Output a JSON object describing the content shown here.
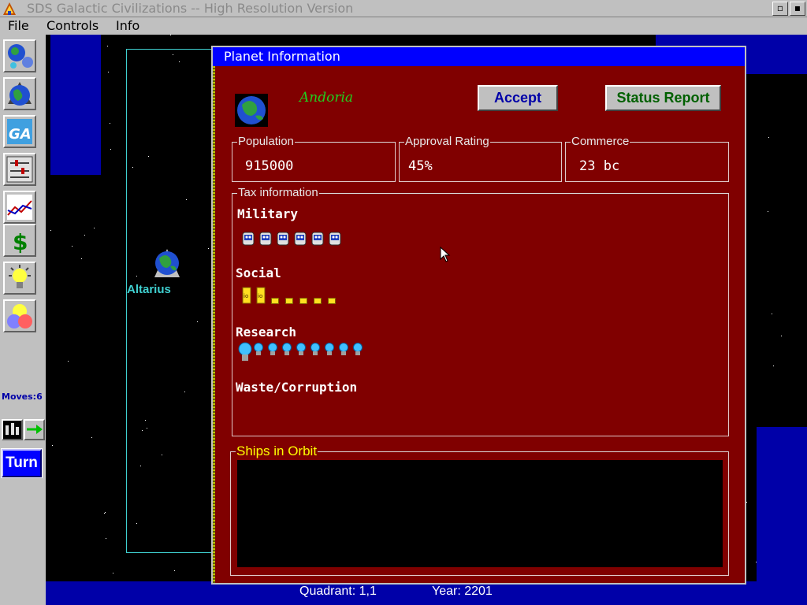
{
  "window": {
    "title": "SDS Galactic Civilizations -- High Resolution Version",
    "restore_label": "▫",
    "close_label": "▪"
  },
  "menu": [
    {
      "label": "File"
    },
    {
      "label": "Controls"
    },
    {
      "label": "Info"
    }
  ],
  "sidebar": {
    "moves_label": "Moves:6",
    "turn_label": "Turn"
  },
  "map": {
    "planet_label": "Altarius"
  },
  "status": {
    "quadrant": "Quadrant: 1,1",
    "year": "Year: 2201"
  },
  "dialog": {
    "title": "Planet Information",
    "planet_name": "Andoria",
    "accept_label": "Accept",
    "status_report_label": "Status Report",
    "population": {
      "legend": "Population",
      "value": "915000"
    },
    "approval": {
      "legend": "Approval Rating",
      "value": "45%"
    },
    "commerce": {
      "legend": "Commerce",
      "value": "23 bc"
    },
    "tax": {
      "legend": "Tax information",
      "military": {
        "label": "Military",
        "count": 6
      },
      "social": {
        "label": "Social",
        "active": 2,
        "count": 7
      },
      "research": {
        "label": "Research",
        "count": 9
      },
      "waste": {
        "label": "Waste/Corruption"
      }
    },
    "ships": {
      "legend": "Ships in Orbit"
    }
  },
  "colors": {
    "dialog_bg": "#800000",
    "title_blue": "#0000ff",
    "map_blue": "#0000a8",
    "planet_name_green": "#20d020",
    "ships_legend_yellow": "#ffff00",
    "sector_cyan": "#3fd0d0"
  },
  "icons": [
    "app-icon",
    "galaxy-icon",
    "planet-icon",
    "race-icon",
    "slider-settings-icon",
    "graph-icon",
    "dollar-icon",
    "lightbulb-icon",
    "colored-balls-icon",
    "ship-icon",
    "arrow-right-icon",
    "military-tax-icon",
    "social-tax-icon",
    "research-bulb-icon",
    "cursor-icon"
  ]
}
